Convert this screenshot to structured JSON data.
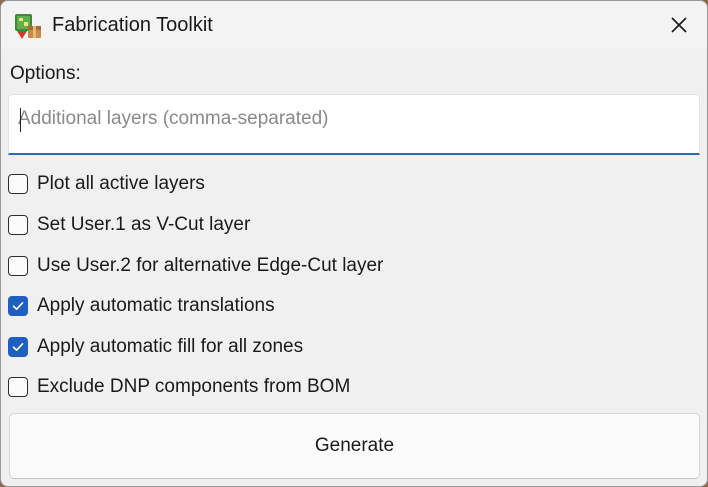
{
  "window": {
    "title": "Fabrication Toolkit",
    "icon": "fabrication-app-icon",
    "close_icon": "close-icon"
  },
  "options": {
    "label": "Options:",
    "layers_input": {
      "value": "",
      "placeholder": "Additional layers (comma-separated)"
    },
    "checkboxes": [
      {
        "label": "Plot all active layers",
        "checked": false
      },
      {
        "label": "Set User.1 as V-Cut layer",
        "checked": false
      },
      {
        "label": "Use User.2 for alternative Edge-Cut layer",
        "checked": false
      },
      {
        "label": "Apply automatic translations",
        "checked": true
      },
      {
        "label": "Apply automatic fill for all zones",
        "checked": true
      },
      {
        "label": "Exclude DNP components from BOM",
        "checked": false
      }
    ]
  },
  "actions": {
    "generate_label": "Generate"
  },
  "colors": {
    "accent": "#1f5fc1",
    "input_underline": "#2a6bbd",
    "window_bg": "#f0f0f0"
  }
}
